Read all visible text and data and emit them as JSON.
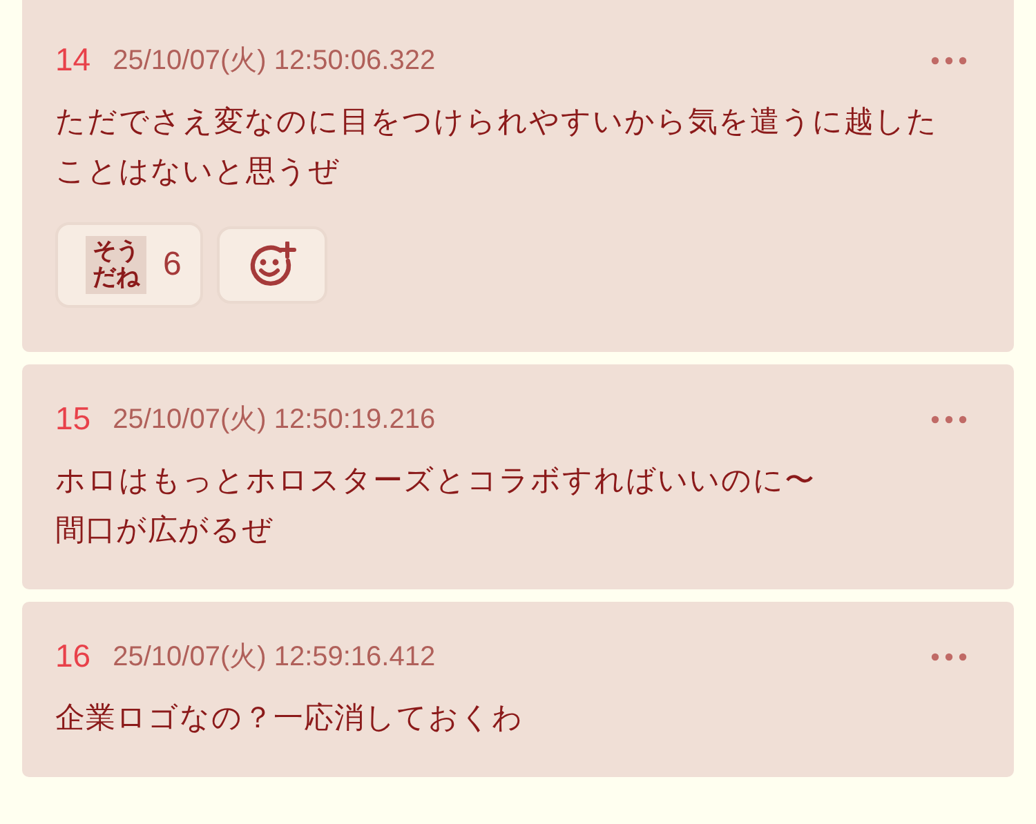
{
  "posts": [
    {
      "number": "14",
      "date": "25/10/07(火) 12:50:06.322",
      "lines": [
        "ただでさえ変なのに目をつけられやすいから気を遣うに越したことはないと思うぜ"
      ],
      "reactions": [
        {
          "kind": "stamp",
          "label": "そうだね",
          "count": "6"
        },
        {
          "kind": "add"
        }
      ]
    },
    {
      "number": "15",
      "date": "25/10/07(火) 12:50:19.216",
      "lines": [
        "ホロはもっとホロスターズとコラボすればいいのに〜",
        "間口が広がるぜ"
      ]
    },
    {
      "number": "16",
      "date": "25/10/07(火) 12:59:16.412",
      "lines": [
        "企業ロゴなの？一応消しておくわ"
      ]
    }
  ]
}
